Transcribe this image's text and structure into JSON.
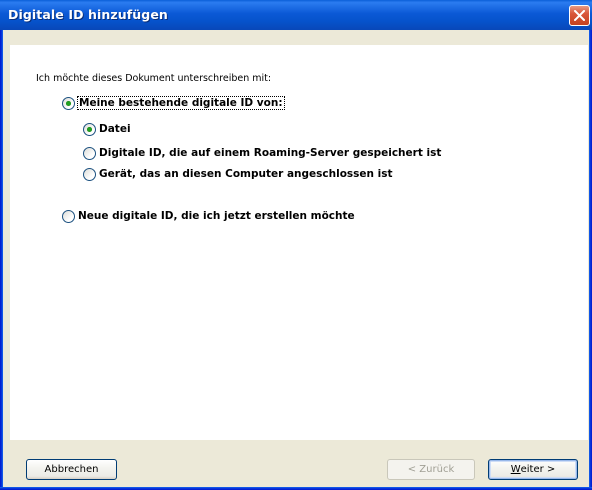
{
  "window": {
    "title": "Digitale ID hinzufügen",
    "close_label": "Close"
  },
  "intro": "Ich möchte dieses Dokument unterschreiben mit:",
  "options": {
    "existing": {
      "label": "Meine bestehende digitale ID von:",
      "checked": true,
      "sub": [
        {
          "label": "Datei",
          "checked": true
        },
        {
          "label": "Digitale ID, die auf einem Roaming-Server gespeichert ist",
          "checked": false
        },
        {
          "label": "Gerät, das an diesen Computer angeschlossen ist",
          "checked": false
        }
      ]
    },
    "new": {
      "label": "Neue digitale ID, die ich jetzt erstellen möchte",
      "checked": false
    }
  },
  "buttons": {
    "cancel": "Abbrechen",
    "back": "< Zurück",
    "next_mnemonic": "W",
    "next_rest": "eiter >"
  },
  "colors": {
    "title_bar": "#0A5FD8",
    "dialog_bg": "#ECE9D8",
    "content_bg": "#FFFFFF",
    "radio_checked": "#21A121"
  }
}
